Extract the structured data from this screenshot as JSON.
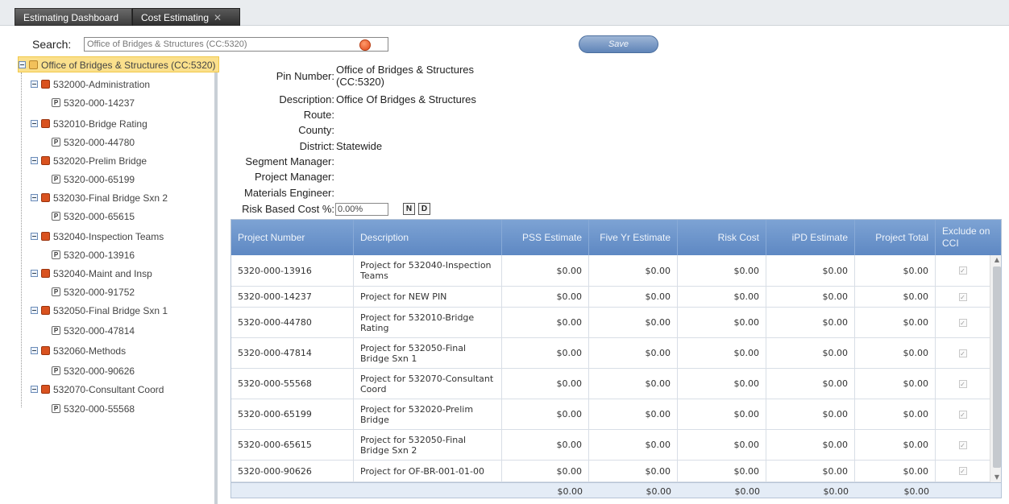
{
  "tabs": [
    {
      "label": "Estimating Dashboard"
    },
    {
      "label": "Cost Estimating",
      "close": "✕"
    }
  ],
  "search": {
    "label": "Search:",
    "value": "Office of Bridges & Structures (CC:5320)"
  },
  "toolbar": {
    "save_label": "Save"
  },
  "tree": {
    "root": "Office of Bridges & Structures (CC:5320)",
    "nodes": [
      {
        "label": "532000-Administration",
        "pin": "5320-000-14237"
      },
      {
        "label": "532010-Bridge Rating",
        "pin": "5320-000-44780"
      },
      {
        "label": "532020-Prelim Bridge",
        "pin": "5320-000-65199"
      },
      {
        "label": "532030-Final Bridge Sxn 2",
        "pin": "5320-000-65615"
      },
      {
        "label": "532040-Inspection Teams",
        "pin": "5320-000-13916"
      },
      {
        "label": "532040-Maint and Insp",
        "pin": "5320-000-91752"
      },
      {
        "label": "532050-Final Bridge Sxn 1",
        "pin": "5320-000-47814"
      },
      {
        "label": "532060-Methods",
        "pin": "5320-000-90626"
      },
      {
        "label": "532070-Consultant Coord",
        "pin": "5320-000-55568"
      }
    ],
    "icons": {
      "root": "S",
      "pin": "P"
    }
  },
  "details": {
    "pin_label": "Pin Number:",
    "pin_value_line1": "Office of Bridges & Structures",
    "pin_value_line2": "(CC:5320)",
    "description_label": "Description:",
    "description_value": "Office Of Bridges & Structures",
    "route_label": "Route:",
    "county_label": "County:",
    "district_label": "District:",
    "district_value": "Statewide",
    "segment_manager_label": "Segment Manager:",
    "project_manager_label": "Project Manager:",
    "materials_engineer_label": "Materials Engineer:",
    "risk_label": "Risk Based Cost %:",
    "risk_value": "0.00%",
    "n_button": "N",
    "d_button": "D"
  },
  "grid": {
    "headers": [
      "Project Number",
      "Description",
      "PSS Estimate",
      "Five Yr Estimate",
      "Risk Cost",
      "iPD Estimate",
      "Project Total",
      "Exclude on CCI"
    ],
    "rows": [
      {
        "project_number": "5320-000-13916",
        "description": "Project for 532040-Inspection Teams",
        "pss": "$0.00",
        "five_yr": "$0.00",
        "risk": "$0.00",
        "ipd": "$0.00",
        "total": "$0.00"
      },
      {
        "project_number": "5320-000-14237",
        "description": "Project for NEW PIN",
        "pss": "$0.00",
        "five_yr": "$0.00",
        "risk": "$0.00",
        "ipd": "$0.00",
        "total": "$0.00"
      },
      {
        "project_number": "5320-000-44780",
        "description": "Project for 532010-Bridge Rating",
        "pss": "$0.00",
        "five_yr": "$0.00",
        "risk": "$0.00",
        "ipd": "$0.00",
        "total": "$0.00"
      },
      {
        "project_number": "5320-000-47814",
        "description": "Project for 532050-Final Bridge Sxn 1",
        "pss": "$0.00",
        "five_yr": "$0.00",
        "risk": "$0.00",
        "ipd": "$0.00",
        "total": "$0.00"
      },
      {
        "project_number": "5320-000-55568",
        "description": "Project for 532070-Consultant Coord",
        "pss": "$0.00",
        "five_yr": "$0.00",
        "risk": "$0.00",
        "ipd": "$0.00",
        "total": "$0.00"
      },
      {
        "project_number": "5320-000-65199",
        "description": "Project for 532020-Prelim Bridge",
        "pss": "$0.00",
        "five_yr": "$0.00",
        "risk": "$0.00",
        "ipd": "$0.00",
        "total": "$0.00"
      },
      {
        "project_number": "5320-000-65615",
        "description": "Project for 532050-Final Bridge Sxn 2",
        "pss": "$0.00",
        "five_yr": "$0.00",
        "risk": "$0.00",
        "ipd": "$0.00",
        "total": "$0.00"
      },
      {
        "project_number": "5320-000-90626",
        "description": "Project for OF-BR-001-01-00",
        "pss": "$0.00",
        "five_yr": "$0.00",
        "risk": "$0.00",
        "ipd": "$0.00",
        "total": "$0.00"
      }
    ],
    "checkmark": "✓",
    "totals": {
      "pss": "$0.00",
      "five_yr": "$0.00",
      "risk": "$0.00",
      "ipd": "$0.00",
      "total": "$0.00"
    }
  }
}
